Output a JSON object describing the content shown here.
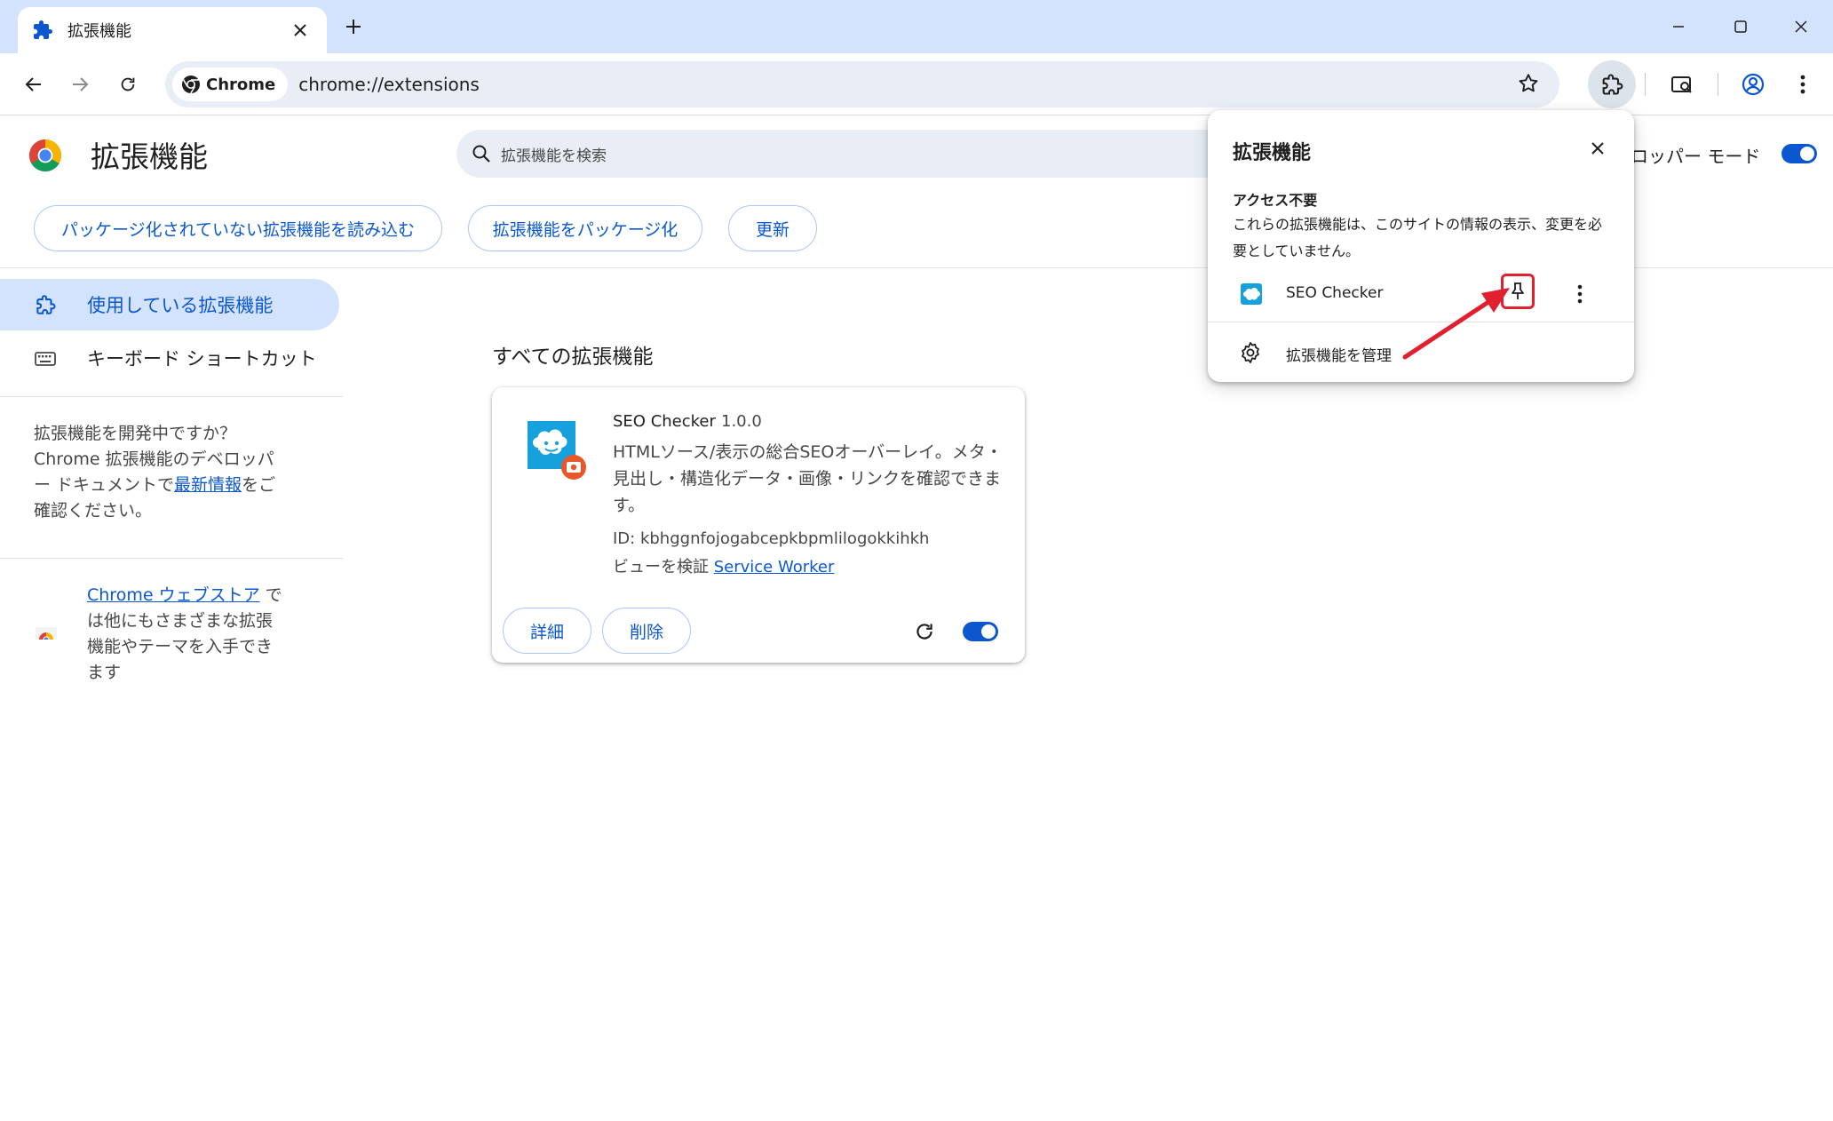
{
  "tab": {
    "title": "拡張機能"
  },
  "omnibox": {
    "chip_label": "Chrome",
    "url": "chrome://extensions"
  },
  "page": {
    "title": "拡張機能",
    "search_placeholder": "拡張機能を検索",
    "developer_mode_label": "ロッパー モード",
    "developer_mode_on": true,
    "buttons": {
      "load_unpacked": "パッケージ化されていない拡張機能を読み込む",
      "pack": "拡張機能をパッケージ化",
      "update": "更新"
    }
  },
  "sidebar": {
    "items": [
      {
        "label": "使用している拡張機能",
        "active": true
      },
      {
        "label": "キーボード ショートカット",
        "active": false
      }
    ],
    "dev_prompt": {
      "line1": "拡張機能を開発中ですか？",
      "line2": "Chrome 拡張機能のデベロッパ",
      "line3_pre": "ー ドキュメントで",
      "link": "最新情報",
      "line3_post": "をご",
      "line4": "確認ください。"
    },
    "webstore": {
      "link": "Chrome ウェブストア",
      "after_link": " で",
      "line2": "は他にもさまざまな拡張",
      "line3": "機能やテーマを入手でき",
      "line4": "ます"
    }
  },
  "main": {
    "section_title": "すべての拡張機能",
    "extension": {
      "name": "SEO Checker",
      "version": "1.0.0",
      "description": "HTMLソース/表示の総合SEOオーバーレイ。メタ・見出し・構造化データ・画像・リンクを確認できます。",
      "id_label": "ID: kbhggnfojogabcepkbpmlilogokkihkh",
      "inspect_label": "ビューを検証",
      "inspect_link": "Service Worker",
      "details_button": "詳細",
      "remove_button": "削除",
      "enabled": true
    }
  },
  "popup": {
    "title": "拡張機能",
    "section": "アクセス不要",
    "description": "これらの拡張機能は、このサイトの情報の表示、変更を必要としていません。",
    "extension_name": "SEO Checker",
    "manage_label": "拡張機能を管理"
  },
  "colors": {
    "accent": "#0b57d0",
    "tabstrip": "#d3e3fd",
    "highlight": "#e0202e"
  }
}
